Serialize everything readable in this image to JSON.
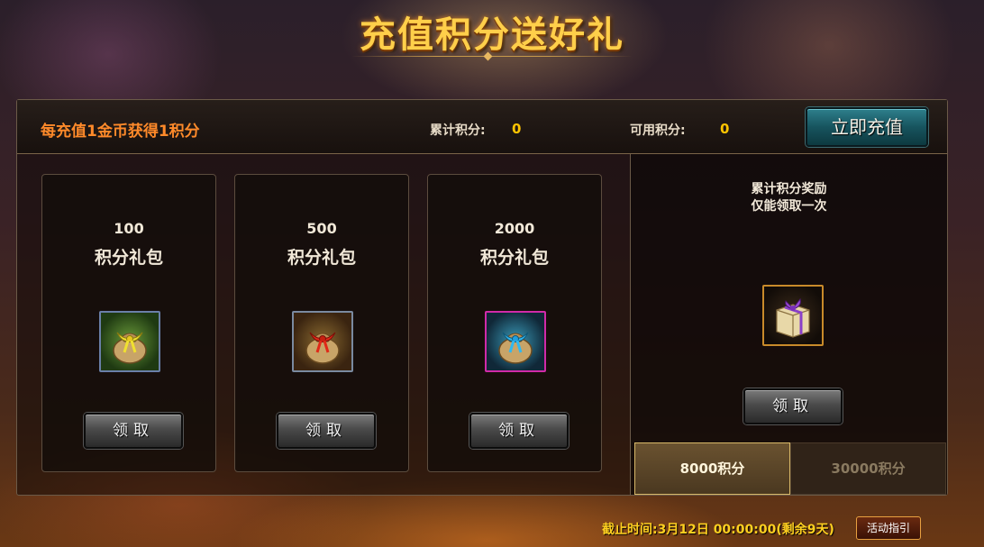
{
  "header": {
    "title": "充值积分送好礼"
  },
  "topbar": {
    "rate_text": "每充值1金币获得1积分",
    "total_label": "累计积分:",
    "total_value": "0",
    "available_label": "可用积分:",
    "available_value": "0",
    "recharge_label": "立即充值"
  },
  "cards": [
    {
      "points": "100",
      "name": "积分礼包",
      "icon": "green-yellow-ribbon-bag-icon",
      "claim": "领取"
    },
    {
      "points": "500",
      "name": "积分礼包",
      "icon": "brown-red-ribbon-bag-icon",
      "claim": "领取"
    },
    {
      "points": "2000",
      "name": "积分礼包",
      "icon": "blue-ribbon-bag-icon",
      "claim": "领取"
    }
  ],
  "reward": {
    "title_line1": "累计积分奖励",
    "title_line2": "仅能领取一次",
    "icon": "purple-ribbon-gift-box-icon",
    "claim": "领取"
  },
  "tabs": [
    {
      "label": "8000积分",
      "active": true
    },
    {
      "label": "30000积分",
      "active": false
    }
  ],
  "footer": {
    "deadline": "截止时间:3月12日 00:00:00(剩余9天)",
    "guide_label": "活动指引"
  },
  "colors": {
    "title": "#ffcf4a",
    "rate_text": "#ff8a2a",
    "value": "#ffc400",
    "recharge_button": "#17545e",
    "deadline": "#ffd020"
  }
}
